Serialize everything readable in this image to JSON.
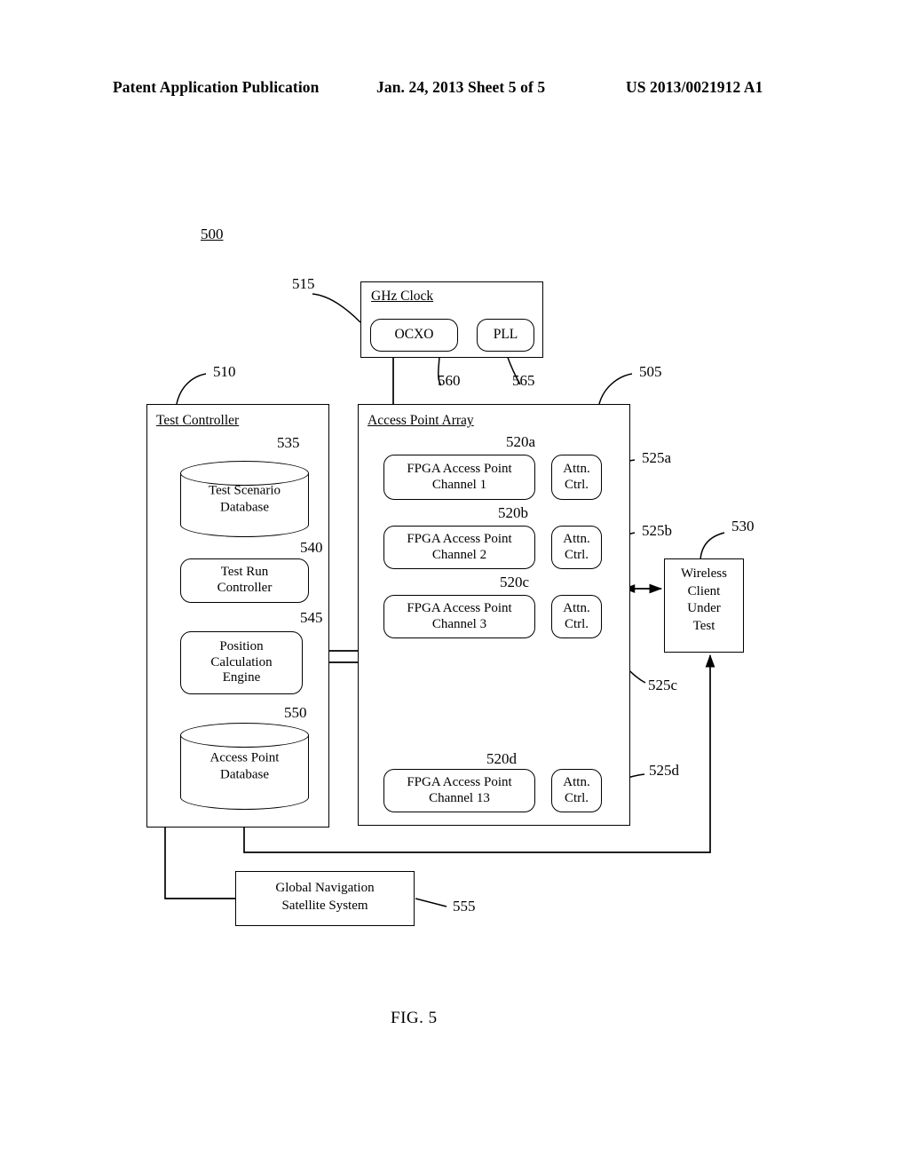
{
  "header": {
    "publication": "Patent Application Publication",
    "date_sheet": "Jan. 24, 2013  Sheet 5 of 5",
    "patent_number": "US 2013/0021912 A1"
  },
  "figure": {
    "caption": "FIG. 5",
    "system_ref": "500"
  },
  "clock_group": {
    "title": "GHz Clock",
    "ref": "515",
    "blocks": [
      {
        "label": "OCXO",
        "ref": "560"
      },
      {
        "label": "PLL",
        "ref": "565"
      }
    ]
  },
  "test_controller": {
    "title": "Test Controller",
    "ref": "510",
    "blocks": [
      {
        "name": "test-scenario-database",
        "label": "Test Scenario\nDatabase",
        "line1": "Test Scenario",
        "line2": "Database",
        "ref": "535",
        "shape": "cylinder"
      },
      {
        "name": "test-run-controller",
        "line1": "Test Run",
        "line2": "Controller",
        "ref": "540",
        "shape": "rounded"
      },
      {
        "name": "position-calculation-engine",
        "line1": "Position",
        "line2": "Calculation",
        "line3": "Engine",
        "ref": "545",
        "shape": "rounded"
      },
      {
        "name": "access-point-database",
        "line1": "Access Point",
        "line2": "Database",
        "ref": "550",
        "shape": "cylinder"
      }
    ]
  },
  "access_point_array": {
    "title": "Access Point Array",
    "ref": "505",
    "channels": [
      {
        "line1": "FPGA Access Point",
        "line2": "Channel 1",
        "ref": "520a",
        "attn_line1": "Attn.",
        "attn_line2": "Ctrl.",
        "attn_ref": "525a"
      },
      {
        "line1": "FPGA Access Point",
        "line2": "Channel 2",
        "ref": "520b",
        "attn_line1": "Attn.",
        "attn_line2": "Ctrl.",
        "attn_ref": "525b"
      },
      {
        "line1": "FPGA Access Point",
        "line2": "Channel 3",
        "ref": "520c",
        "attn_line1": "Attn.",
        "attn_line2": "Ctrl.",
        "attn_ref": "525c"
      },
      {
        "line1": "FPGA Access Point",
        "line2": "Channel 13",
        "ref": "520d",
        "attn_line1": "Attn.",
        "attn_line2": "Ctrl.",
        "attn_ref": "525d"
      }
    ]
  },
  "wireless_client": {
    "line1": "Wireless",
    "line2": "Client",
    "line3": "Under",
    "line4": "Test",
    "ref": "530"
  },
  "gnss": {
    "line1": "Global Navigation",
    "line2": "Satellite System",
    "ref": "555"
  }
}
